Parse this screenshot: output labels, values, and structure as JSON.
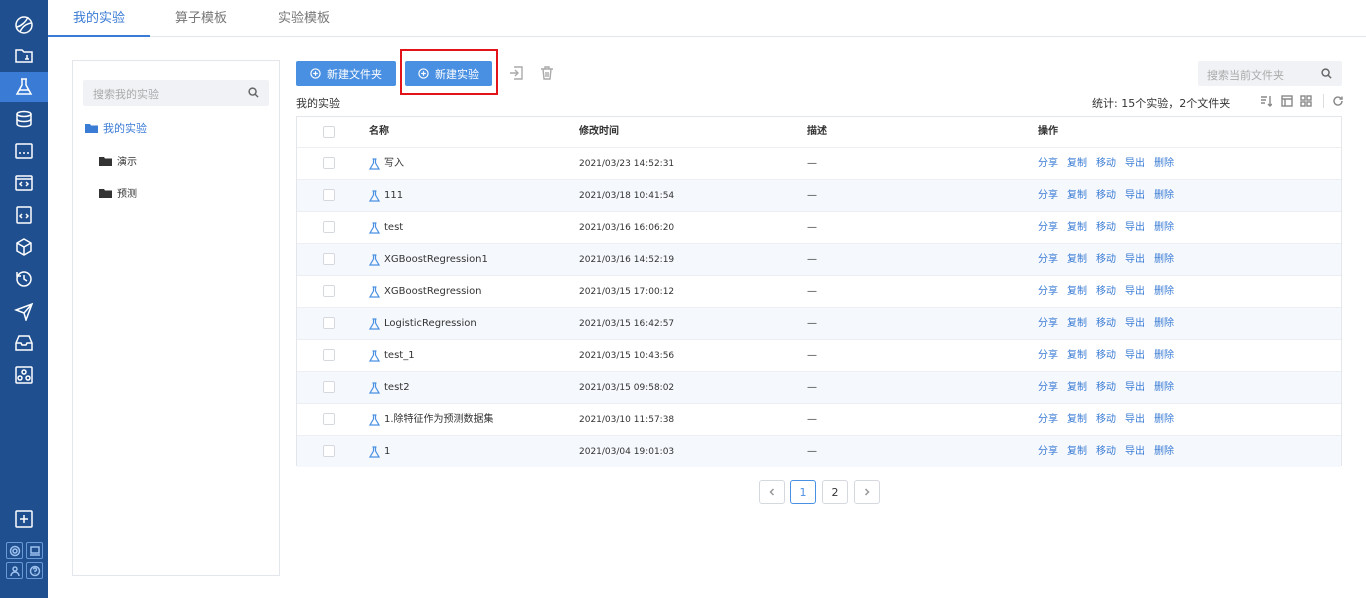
{
  "tabs": [
    "我的实验",
    "算子模板",
    "实验模板"
  ],
  "tree": {
    "search_placeholder": "搜索我的实验",
    "root": "我的实验",
    "children": [
      "演示",
      "预测"
    ]
  },
  "toolbar": {
    "new_folder": "新建文件夹",
    "new_experiment": "新建实验",
    "search_placeholder": "搜索当前文件夹"
  },
  "section_title": "我的实验",
  "stats": "统计: 15个实验，2个文件夹",
  "table": {
    "headers": {
      "name": "名称",
      "modified": "修改时间",
      "desc": "描述",
      "ops": "操作"
    },
    "rows": [
      {
        "name": "写入",
        "time": "2021/03/23 14:52:31",
        "desc": "—"
      },
      {
        "name": "111",
        "time": "2021/03/18 10:41:54",
        "desc": "—"
      },
      {
        "name": "test",
        "time": "2021/03/16 16:06:20",
        "desc": "—"
      },
      {
        "name": "XGBoostRegression1",
        "time": "2021/03/16 14:52:19",
        "desc": "—"
      },
      {
        "name": "XGBoostRegression",
        "time": "2021/03/15 17:00:12",
        "desc": "—"
      },
      {
        "name": "LogisticRegression",
        "time": "2021/03/15 16:42:57",
        "desc": "—"
      },
      {
        "name": "test_1",
        "time": "2021/03/15 10:43:56",
        "desc": "—"
      },
      {
        "name": "test2",
        "time": "2021/03/15 09:58:02",
        "desc": "—"
      },
      {
        "name": "1.除特征作为预测数据集",
        "time": "2021/03/10 11:57:38",
        "desc": "—"
      },
      {
        "name": "1",
        "time": "2021/03/04 19:01:03",
        "desc": "—"
      }
    ],
    "actions": [
      "分享",
      "复制",
      "移动",
      "导出",
      "删除"
    ]
  },
  "pagination": {
    "pages": [
      "1",
      "2"
    ],
    "current": "1"
  },
  "colors": {
    "rail": "#1f4f8f",
    "accent": "#4a90e2",
    "highlight": "#e2141a"
  }
}
